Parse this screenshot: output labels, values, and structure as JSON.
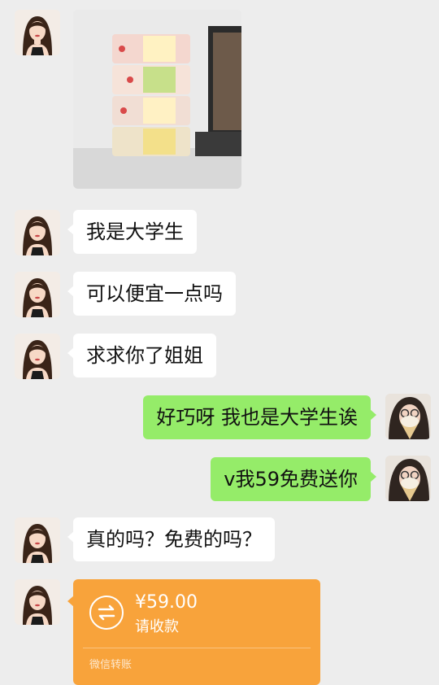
{
  "chat": {
    "messages": [
      {
        "from": "contact",
        "type": "image",
        "icon": "cake-photo"
      },
      {
        "from": "contact",
        "type": "text",
        "text": "我是大学生"
      },
      {
        "from": "contact",
        "type": "text",
        "text": "可以便宜一点吗"
      },
      {
        "from": "contact",
        "type": "text",
        "text": "求求你了姐姐"
      },
      {
        "from": "me",
        "type": "text",
        "text": "好巧呀 我也是大学生诶"
      },
      {
        "from": "me",
        "type": "text",
        "text": "v我59免费送你"
      },
      {
        "from": "contact",
        "type": "text",
        "text": "真的吗？免费的吗？"
      },
      {
        "from": "contact",
        "type": "transfer",
        "amount": "¥59.00",
        "label": "请收款",
        "footer": "微信转账"
      }
    ]
  },
  "colors": {
    "background": "#ededed",
    "incoming_bubble": "#ffffff",
    "outgoing_bubble": "#95ec69",
    "transfer_card": "#f8a33b"
  }
}
